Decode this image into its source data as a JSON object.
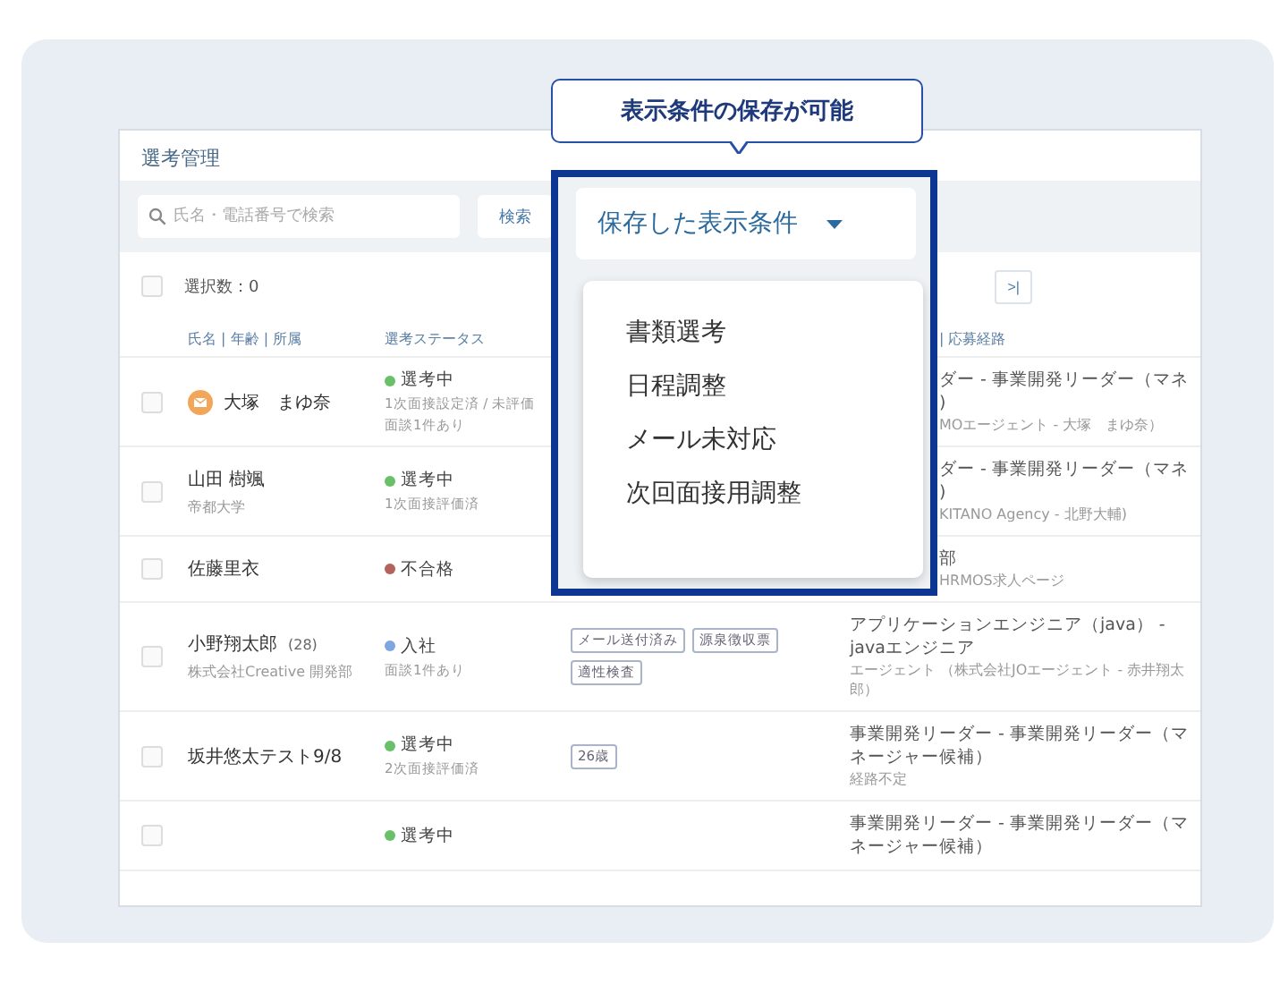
{
  "header": {
    "title": "選考管理"
  },
  "toolbar": {
    "search": {
      "placeholder": "氏名・電話番号で検索"
    },
    "search_button": "検索"
  },
  "selection": {
    "checked": false,
    "label": "選択数：0"
  },
  "pagination": {
    "last_page": ">|"
  },
  "columns": {
    "name": "氏名 | 年齢 | 所属",
    "status": "選考ステータス",
    "route": "| 応募経路"
  },
  "rows": [
    {
      "kind": "flagged",
      "checked": false,
      "name": "大塚　まゆ奈",
      "status": {
        "label": "選考中",
        "color": "#6abf69"
      },
      "status_notes": [
        "1次面接設定済 / 未評価",
        "面談1件あり"
      ],
      "tags": [],
      "behind_overlay": true,
      "job": "ダー - 事業開発リーダー（マネ\n)",
      "route": "MOエージェント - 大塚　まゆ奈）"
    },
    {
      "kind": "plain",
      "checked": false,
      "name": "山田 樹颯",
      "affiliation": "帝都大学",
      "status": {
        "label": "選考中",
        "color": "#6abf69"
      },
      "status_notes": [
        "1次面接評価済"
      ],
      "tags": [],
      "behind_overlay": true,
      "job": "ダー - 事業開発リーダー（マネ\n)",
      "route": "KITANO Agency - 北野大輔)"
    },
    {
      "kind": "plain",
      "checked": false,
      "name": "佐藤里衣",
      "status": {
        "label": "不合格",
        "color": "#b5615c"
      },
      "status_notes": [],
      "tags": [],
      "behind_overlay": true,
      "job": "部",
      "route": "HRMOS求人ページ"
    },
    {
      "kind": "plain",
      "checked": false,
      "name": "小野翔太郎",
      "age": "(28)",
      "affiliation": "株式会社Creative 開発部",
      "status": {
        "label": "入社",
        "color": "#7ea6e0"
      },
      "status_notes": [
        "面談1件あり"
      ],
      "tags": [
        "メール送付済み",
        "源泉徴収票",
        "適性検査"
      ],
      "behind_overlay": false,
      "job": "アプリケーションエンジニア（java） - javaエンジニア",
      "route": "エージェント （株式会社JOエージェント - 赤井翔太郎）"
    },
    {
      "kind": "plain",
      "checked": false,
      "name": "坂井悠太テスト9/8",
      "status": {
        "label": "選考中",
        "color": "#6abf69"
      },
      "status_notes": [
        "2次面接評価済"
      ],
      "tags": [
        "26歳"
      ],
      "behind_overlay": false,
      "job": "事業開発リーダー - 事業開発リーダー（マネージャー候補）",
      "route": "経路不定"
    },
    {
      "kind": "plain",
      "checked": false,
      "status": {
        "label": "選考中",
        "color": "#6abf69"
      },
      "status_notes": [],
      "tags": [],
      "behind_overlay": false,
      "job": "事業開発リーダー - 事業開発リーダー（マネージャー候補）"
    }
  ],
  "callout": "表示条件の保存が可能",
  "saved_views": {
    "label": "保存した表示条件",
    "expanded": true,
    "items": [
      "書類選考",
      "日程調整",
      "メール未対応",
      "次回面接用調整"
    ]
  }
}
